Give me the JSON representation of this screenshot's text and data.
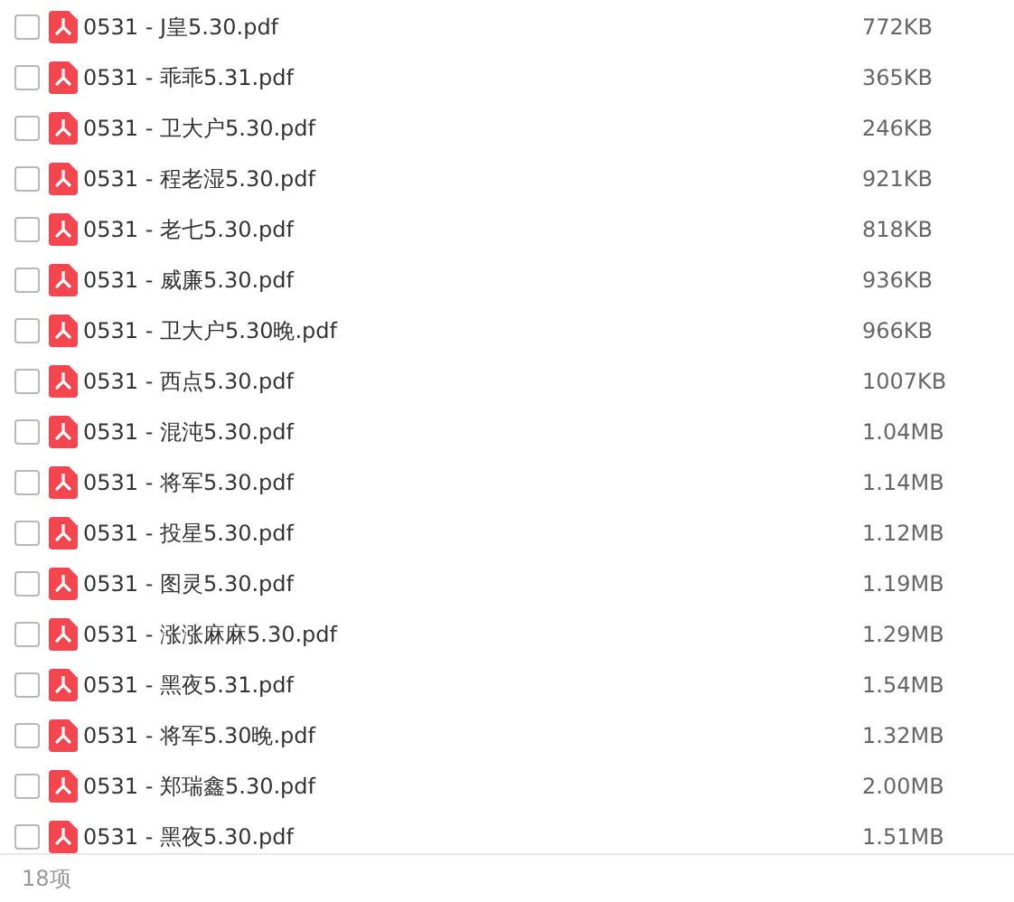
{
  "files": [
    {
      "name": "0531 - J皇5.30.pdf",
      "size": "772KB",
      "checked": false
    },
    {
      "name": "0531 - 乖乖5.31.pdf",
      "size": "365KB",
      "checked": false
    },
    {
      "name": "0531 - 卫大户5.30.pdf",
      "size": "246KB",
      "checked": false
    },
    {
      "name": "0531 - 程老湿5.30.pdf",
      "size": "921KB",
      "checked": false
    },
    {
      "name": "0531 - 老七5.30.pdf",
      "size": "818KB",
      "checked": false
    },
    {
      "name": "0531 - 威廉5.30.pdf",
      "size": "936KB",
      "checked": false
    },
    {
      "name": "0531 - 卫大户5.30晚.pdf",
      "size": "966KB",
      "checked": false
    },
    {
      "name": "0531 - 西点5.30.pdf",
      "size": "1007KB",
      "checked": false
    },
    {
      "name": "0531 - 混沌5.30.pdf",
      "size": "1.04MB",
      "checked": false
    },
    {
      "name": "0531 - 将军5.30.pdf",
      "size": "1.14MB",
      "checked": false
    },
    {
      "name": "0531 - 投星5.30.pdf",
      "size": "1.12MB",
      "checked": false
    },
    {
      "name": "0531 - 图灵5.30.pdf",
      "size": "1.19MB",
      "checked": false
    },
    {
      "name": "0531 - 涨涨麻麻5.30.pdf",
      "size": "1.29MB",
      "checked": false
    },
    {
      "name": "0531 - 黑夜5.31.pdf",
      "size": "1.54MB",
      "checked": false
    },
    {
      "name": "0531 - 将军5.30晚.pdf",
      "size": "1.32MB",
      "checked": false
    },
    {
      "name": "0531 - 郑瑞鑫5.30.pdf",
      "size": "2.00MB",
      "checked": false
    },
    {
      "name": "0531 - 黑夜5.30.pdf",
      "size": "1.51MB",
      "checked": false
    }
  ],
  "footer": {
    "count": "18项"
  }
}
